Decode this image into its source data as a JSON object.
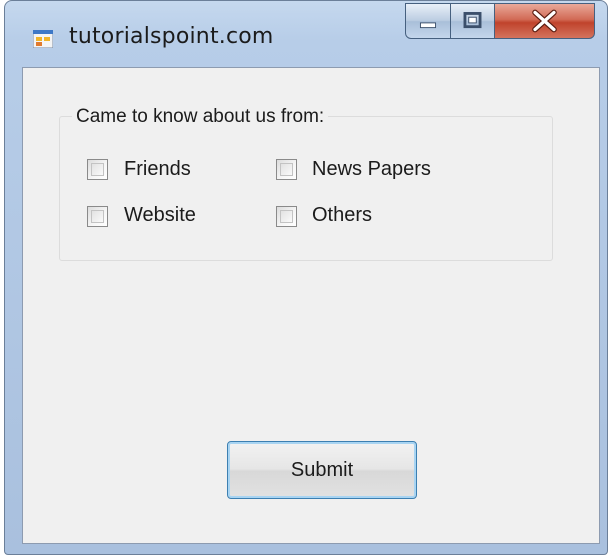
{
  "window": {
    "title": "tutorialspoint.com"
  },
  "form": {
    "group_label": "Came to know about us from:",
    "options": {
      "friends": "Friends",
      "news_papers": "News Papers",
      "website": "Website",
      "others": "Others"
    },
    "submit_label": "Submit"
  },
  "icons": {
    "app": "app-form-icon",
    "minimize": "minimize-icon",
    "maximize": "maximize-icon",
    "close": "close-icon"
  },
  "colors": {
    "title_bar": "#b7cde8",
    "close_button": "#c0432c",
    "client_area": "#f0f0f0",
    "button_focus": "#3c7fb1"
  }
}
